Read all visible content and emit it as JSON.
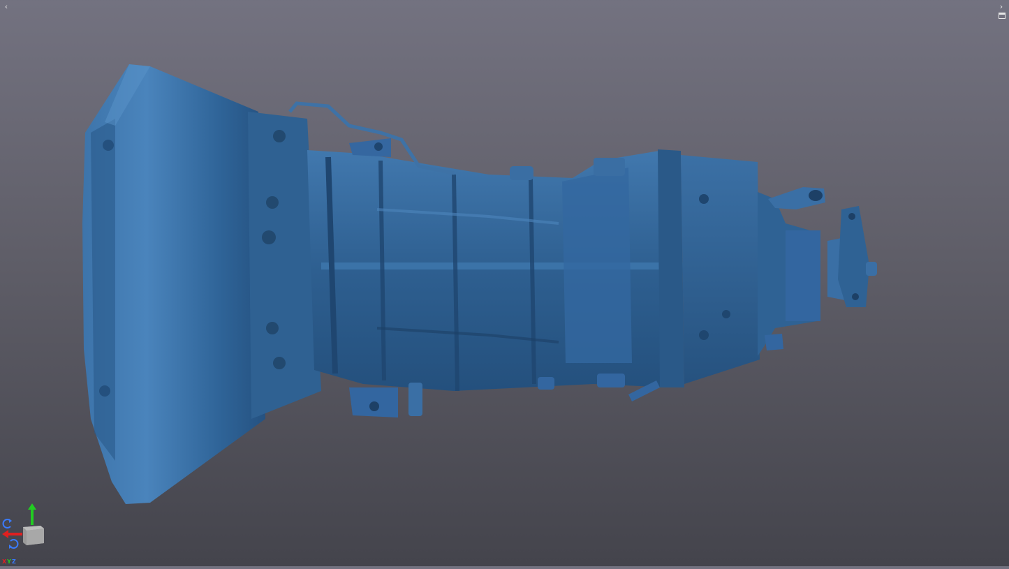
{
  "viewer": {
    "background_top": "#737280",
    "background_bottom": "#44444c",
    "model_color": "#2f5f8e",
    "model_highlight": "#4f87bd",
    "model_shadow": "#1f4166"
  },
  "nav": {
    "prev_icon": "‹",
    "next_icon": "›"
  },
  "axes": {
    "x_label": "X",
    "y_label": "Y",
    "z_label": "Z",
    "x_color": "#e02020",
    "y_color": "#22cc22",
    "z_color": "#3a7bff"
  }
}
